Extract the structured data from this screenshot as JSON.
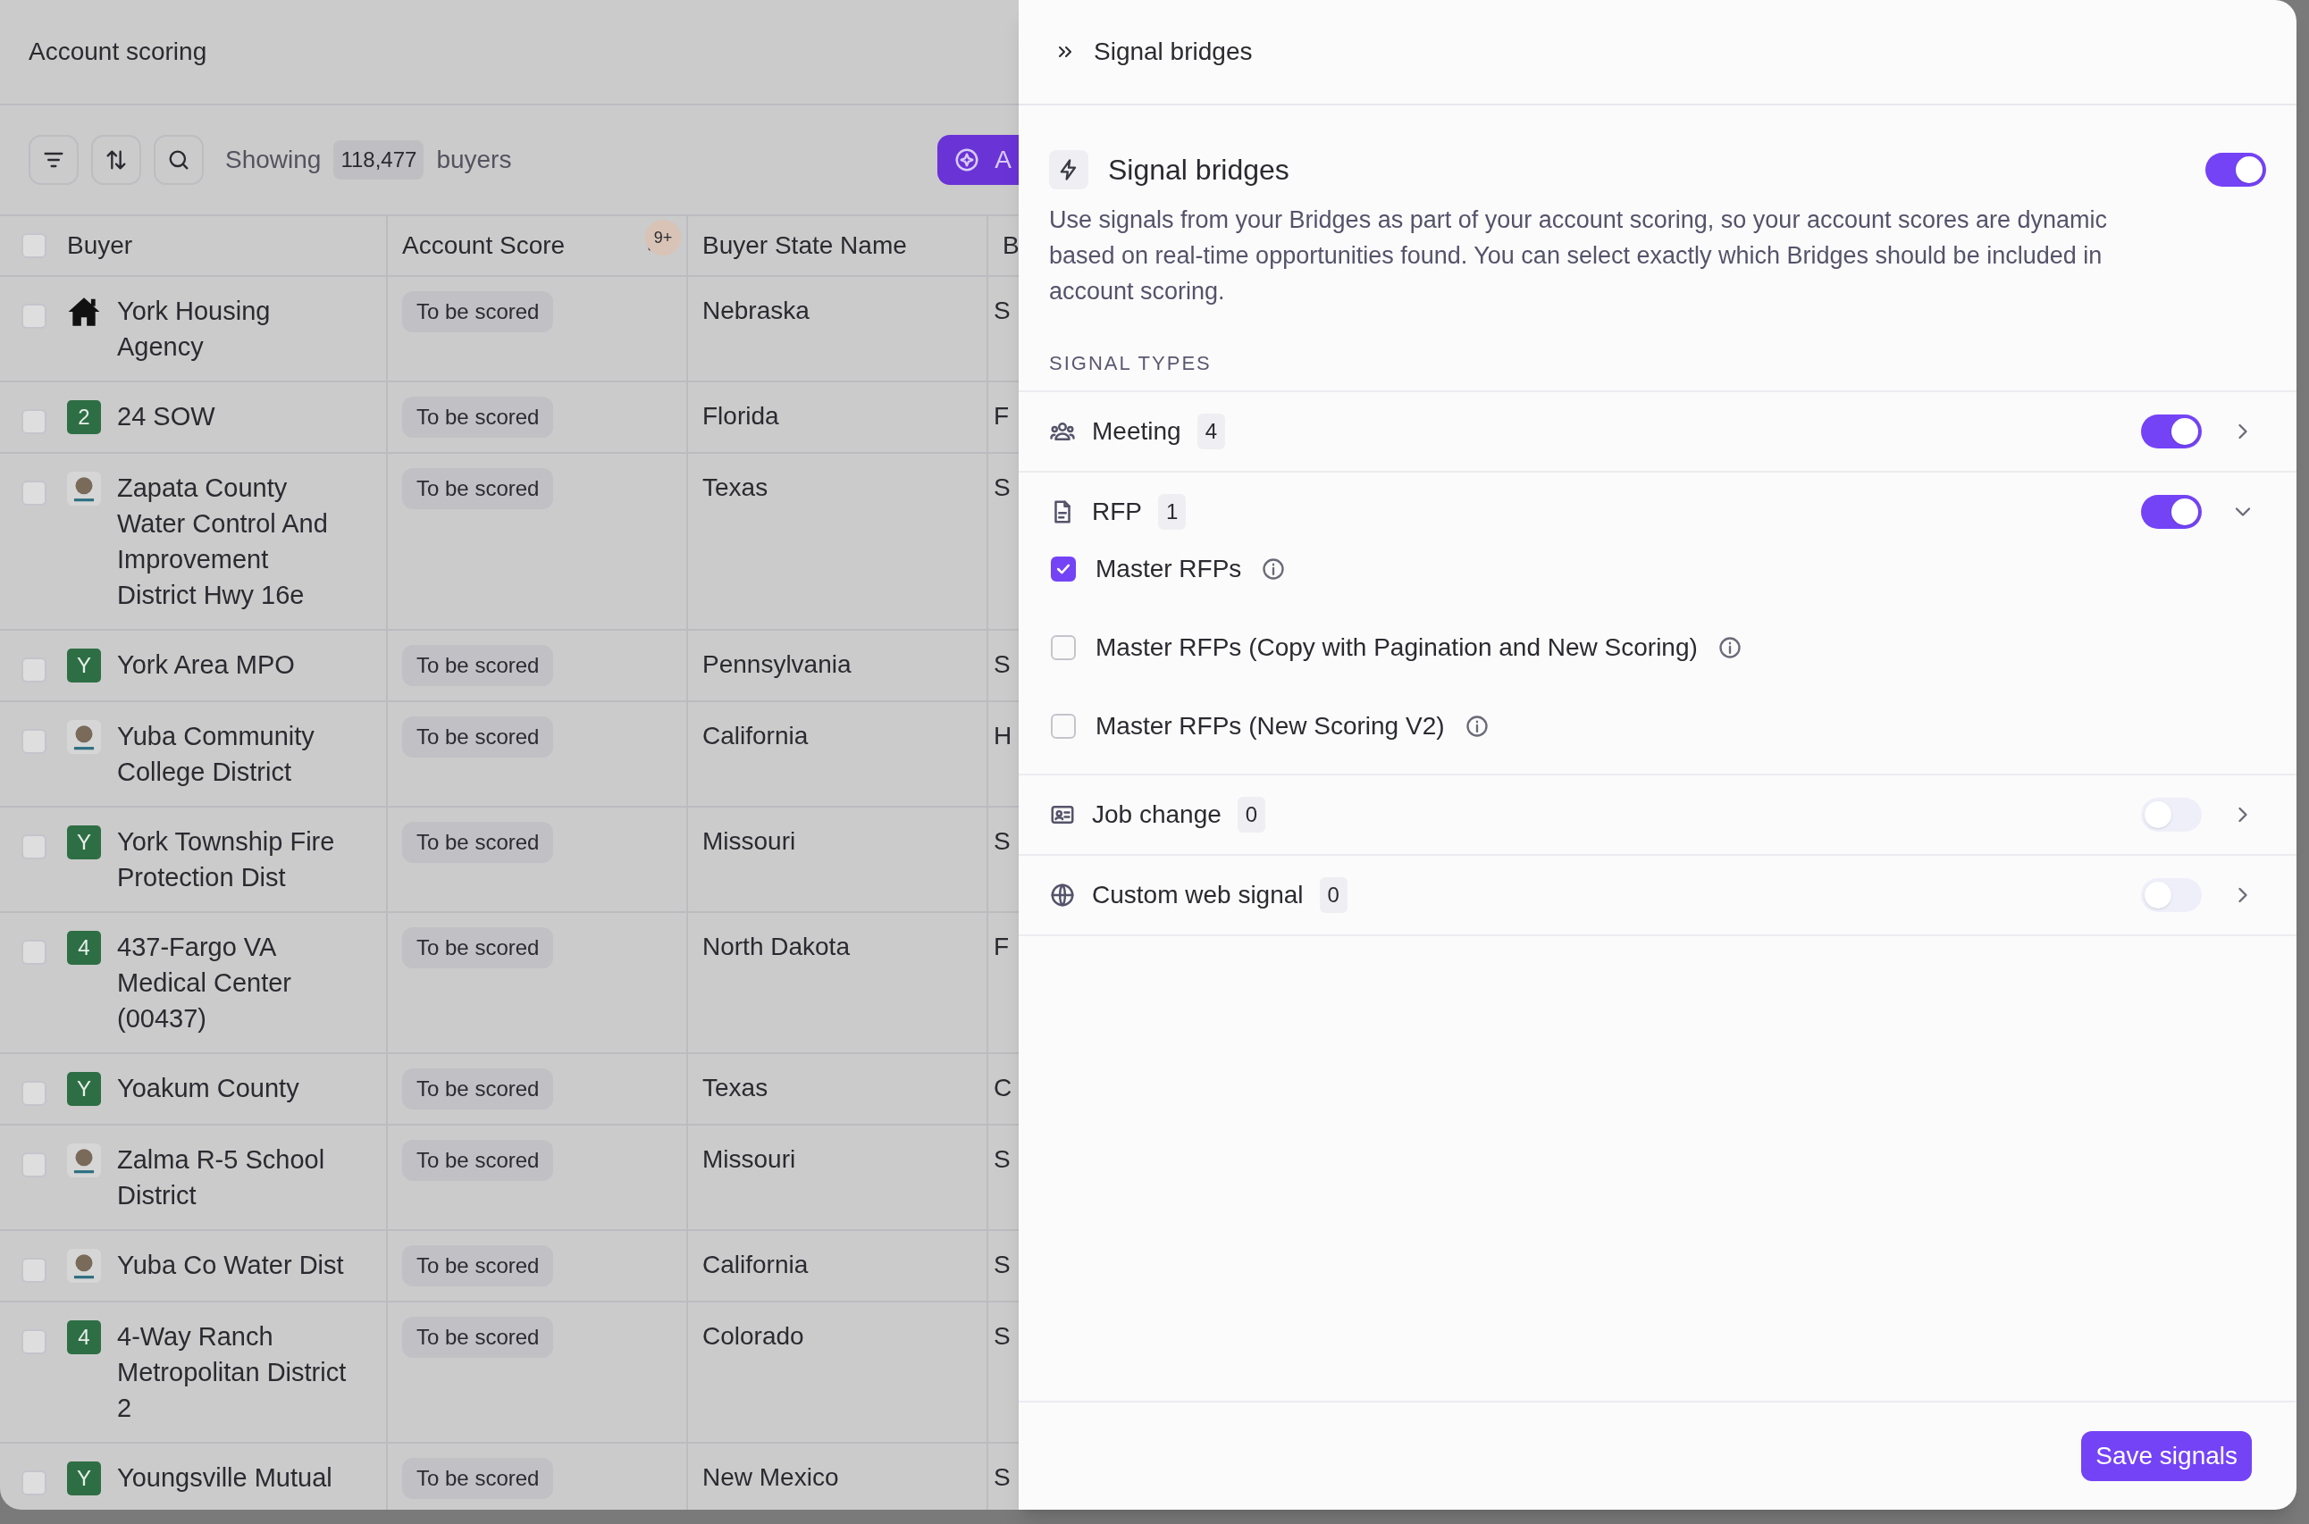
{
  "page": {
    "title": "Account scoring"
  },
  "toolbar": {
    "showing_prefix": "Showing",
    "count": "118,477",
    "showing_suffix": "buyers",
    "add_button": "A"
  },
  "table": {
    "header_checked": false,
    "columns": [
      {
        "label": "Buyer"
      },
      {
        "label": "Account Score",
        "badge": "9+"
      },
      {
        "label": "Buyer State Name"
      },
      {
        "label": "B"
      }
    ],
    "rows": [
      {
        "checked": false,
        "avatar": {
          "kind": "house"
        },
        "buyer": "York Housing Agency",
        "score": "To be scored",
        "state": "Nebraska",
        "column_4": "S"
      },
      {
        "checked": false,
        "avatar": {
          "kind": "letter",
          "letter": "2"
        },
        "buyer": "24 SOW",
        "score": "To be scored",
        "state": "Florida",
        "column_4": "F"
      },
      {
        "checked": false,
        "avatar": {
          "kind": "logo"
        },
        "buyer": "Zapata County Water Control And Improvement District Hwy 16e",
        "score": "To be scored",
        "state": "Texas",
        "column_4": "S"
      },
      {
        "checked": false,
        "avatar": {
          "kind": "letter",
          "letter": "Y"
        },
        "buyer": "York Area MPO",
        "score": "To be scored",
        "state": "Pennsylvania",
        "column_4": "S"
      },
      {
        "checked": false,
        "avatar": {
          "kind": "logo"
        },
        "buyer": "Yuba Community College District",
        "score": "To be scored",
        "state": "California",
        "column_4": "H"
      },
      {
        "checked": false,
        "avatar": {
          "kind": "letter",
          "letter": "Y"
        },
        "buyer": "York Township Fire Protection Dist",
        "score": "To be scored",
        "state": "Missouri",
        "column_4": "S"
      },
      {
        "checked": false,
        "avatar": {
          "kind": "letter",
          "letter": "4"
        },
        "buyer": "437-Fargo VA Medical Center (00437)",
        "score": "To be scored",
        "state": "North Dakota",
        "column_4": "F"
      },
      {
        "checked": false,
        "avatar": {
          "kind": "letter",
          "letter": "Y"
        },
        "buyer": "Yoakum County",
        "score": "To be scored",
        "state": "Texas",
        "column_4": "C"
      },
      {
        "checked": false,
        "avatar": {
          "kind": "logo"
        },
        "buyer": "Zalma R-5 School District",
        "score": "To be scored",
        "state": "Missouri",
        "column_4": "S"
      },
      {
        "checked": false,
        "avatar": {
          "kind": "logo"
        },
        "buyer": "Yuba Co Water Dist",
        "score": "To be scored",
        "state": "California",
        "column_4": "S"
      },
      {
        "checked": false,
        "avatar": {
          "kind": "letter",
          "letter": "4"
        },
        "buyer": "4-Way Ranch Metropolitan District 2",
        "score": "To be scored",
        "state": "Colorado",
        "column_4": "S"
      },
      {
        "checked": false,
        "avatar": {
          "kind": "letter",
          "letter": "Y"
        },
        "buyer": "Youngsville Mutual",
        "score": "To be scored",
        "state": "New Mexico",
        "column_4": "S"
      }
    ]
  },
  "panel": {
    "breadcrumb": "Signal bridges",
    "title": "Signal bridges",
    "on": true,
    "description": "Use signals from your Bridges as part of your account scoring, so your account scores are dynamic based on real-time opportunities found. You can select exactly which Bridges should be included in account scoring.",
    "section_label": "SIGNAL TYPES",
    "signal_types": [
      {
        "kind": "people",
        "label": "Meeting",
        "count": "4",
        "on": true,
        "expanded": false
      },
      {
        "kind": "document",
        "label": "RFP",
        "count": "1",
        "on": true,
        "expanded": true,
        "options": [
          {
            "label": "Master RFPs",
            "checked": true
          },
          {
            "label": "Master RFPs (Copy with Pagination and New Scoring)",
            "checked": false
          },
          {
            "label": "Master RFPs (New Scoring V2)",
            "checked": false
          }
        ]
      },
      {
        "kind": "id-card",
        "label": "Job change",
        "count": "0",
        "on": false,
        "expanded": false
      },
      {
        "kind": "globe",
        "label": "Custom web signal",
        "count": "0",
        "on": false,
        "expanded": false
      }
    ],
    "save_button": "Save signals"
  }
}
